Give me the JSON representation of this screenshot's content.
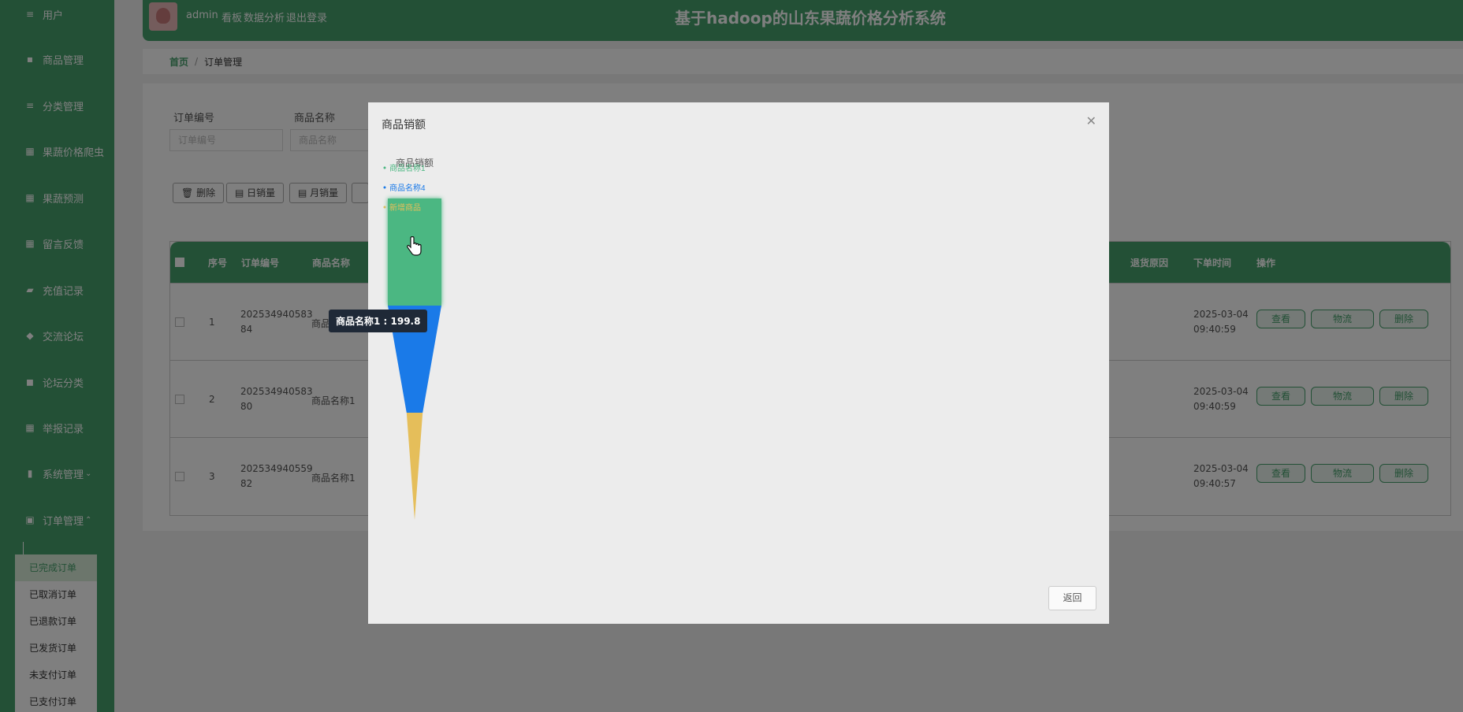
{
  "sidebar": {
    "items": [
      {
        "label": "用户",
        "icon": "list-icon"
      },
      {
        "label": "商品管理",
        "icon": "comment-icon"
      },
      {
        "label": "分类管理",
        "icon": "list-icon"
      },
      {
        "label": "果蔬价格爬虫",
        "icon": "grid-icon"
      },
      {
        "label": "果蔬预测",
        "icon": "grid-icon"
      },
      {
        "label": "留言反馈",
        "icon": "grid-icon"
      },
      {
        "label": "充值记录",
        "icon": "briefcase-icon"
      },
      {
        "label": "交流论坛",
        "icon": "chat-icon"
      },
      {
        "label": "论坛分类",
        "icon": "ticket-icon"
      },
      {
        "label": "举报记录",
        "icon": "grid-icon"
      },
      {
        "label": "系统管理",
        "icon": "bar-chart-icon",
        "arrow": "chevron-down-icon"
      },
      {
        "label": "订单管理",
        "icon": "clipboard-icon",
        "arrow": "chevron-up-icon"
      }
    ],
    "submenu": [
      {
        "label": "已完成订单",
        "active": true
      },
      {
        "label": "已取消订单",
        "active": false
      },
      {
        "label": "已退款订单",
        "active": false
      },
      {
        "label": "已发货订单",
        "active": false
      },
      {
        "label": "未支付订单",
        "active": false
      },
      {
        "label": "已支付订单",
        "active": false
      }
    ]
  },
  "header": {
    "user": "admin",
    "nav_dashboard": "看板",
    "nav_analysis": "数据分析",
    "nav_logout": "退出登录",
    "title": "基于hadoop的山东果蔬价格分析系统"
  },
  "breadcrumb": {
    "home": "首页",
    "separator": "/",
    "current": "订单管理"
  },
  "filters": {
    "order_no_label": "订单编号",
    "order_no_placeholder": "订单编号",
    "product_label": "商品名称",
    "product_placeholder": "商品名称"
  },
  "actions": {
    "delete": "删除",
    "daily_sales": "日销量",
    "monthly_sales": "月销量"
  },
  "table": {
    "headers": {
      "index": "序号",
      "order_no": "订单编号",
      "product": "商品名称",
      "refund_reason": "退货原因",
      "order_time": "下单时间",
      "operation": "操作"
    },
    "rows": [
      {
        "index": "1",
        "order_no_line1": "202534940583",
        "order_no_line2": "84",
        "product": "商品",
        "time_line1": "2025-03-04",
        "time_line2": "09:40:59"
      },
      {
        "index": "2",
        "order_no_line1": "202534940583",
        "order_no_line2": "80",
        "product": "商品名称1",
        "time_line1": "2025-03-04",
        "time_line2": "09:40:59"
      },
      {
        "index": "3",
        "order_no_line1": "202534940559",
        "order_no_line2": "82",
        "product": "商品名称1",
        "time_line1": "2025-03-04",
        "time_line2": "09:40:57"
      }
    ],
    "row_buttons": {
      "view": "查看",
      "logistics": "物流",
      "delete": "删除"
    }
  },
  "dialog": {
    "title": "商品销额",
    "close_icon": "close-icon",
    "back_button": "返回",
    "tooltip": "商品名称1 : 199.8"
  },
  "chart_data": {
    "type": "funnel",
    "title": "商品销额",
    "legend_position": "top-left",
    "series": [
      {
        "name": "商品名称1",
        "value": 199.8,
        "color": "#4cb782"
      },
      {
        "name": "商品名称4",
        "color": "#1a7ae8"
      },
      {
        "name": "新增商品",
        "color": "#e5be5a"
      }
    ]
  },
  "colors": {
    "brand": "#46a06c",
    "overlay": "rgba(0,0,0,0.5)"
  }
}
